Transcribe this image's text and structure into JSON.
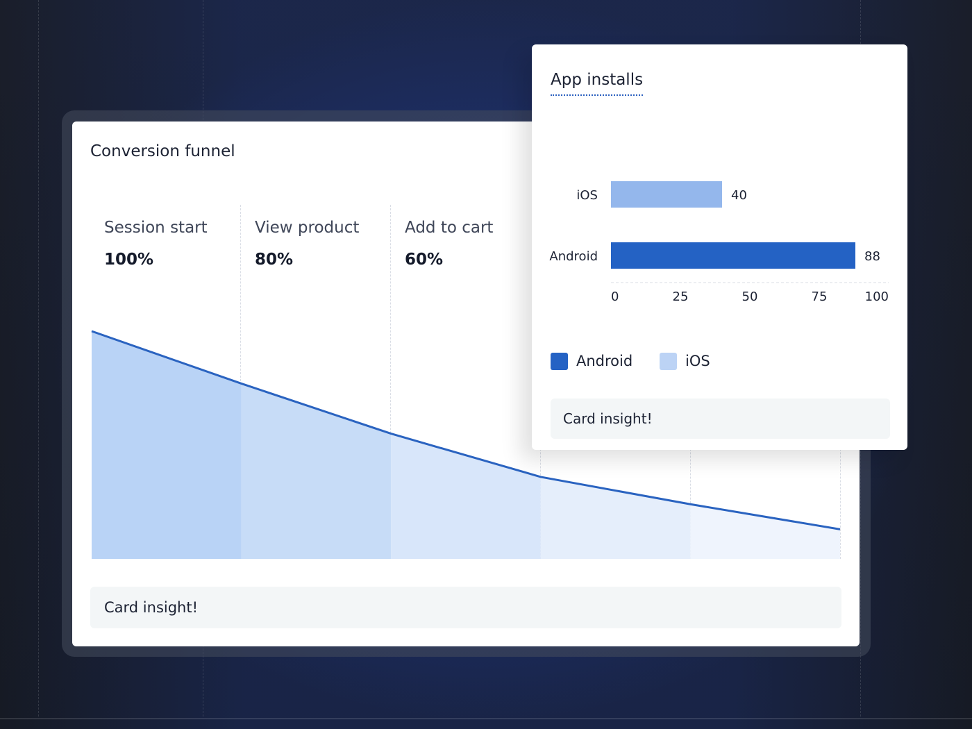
{
  "colors": {
    "android": "#2462c4",
    "ios": "#94b7ec",
    "ios_legend": "#bcd3f5",
    "funnel_line": "#2a63c0",
    "funnel_fills": [
      "#b9d3f6",
      "#c7dcf7",
      "#d8e6fa",
      "#e5eefb",
      "#eff4fd"
    ]
  },
  "funnel_card": {
    "title": "Conversion funnel",
    "insight": "Card insight!"
  },
  "installs_card": {
    "title": "App installs",
    "insight": "Card insight!"
  },
  "chart_data": [
    {
      "type": "area",
      "title": "Conversion funnel",
      "categories": [
        "Session start",
        "View product",
        "Add to cart"
      ],
      "visible_labels": [
        {
          "stage": "Session start",
          "percent_label": "100%"
        },
        {
          "stage": "View product",
          "percent_label": "80%"
        },
        {
          "stage": "Add to cart",
          "percent_label": "60%"
        }
      ],
      "x": [
        0,
        1,
        2,
        3,
        4,
        5
      ],
      "values": [
        100,
        77,
        55,
        36,
        24,
        13
      ],
      "ylim": [
        0,
        100
      ]
    },
    {
      "type": "bar",
      "orientation": "horizontal",
      "title": "App installs",
      "categories": [
        "iOS",
        "Android"
      ],
      "series": [
        {
          "name": "iOS",
          "values": [
            40,
            null
          ]
        },
        {
          "name": "Android",
          "values": [
            null,
            88
          ]
        }
      ],
      "value_labels": [
        "40",
        "88"
      ],
      "xlim": [
        0,
        100
      ],
      "xticks": [
        "0",
        "25",
        "50",
        "75",
        "100"
      ],
      "legend": {
        "position": "bottom-left",
        "entries": [
          "Android",
          "iOS"
        ]
      }
    }
  ]
}
